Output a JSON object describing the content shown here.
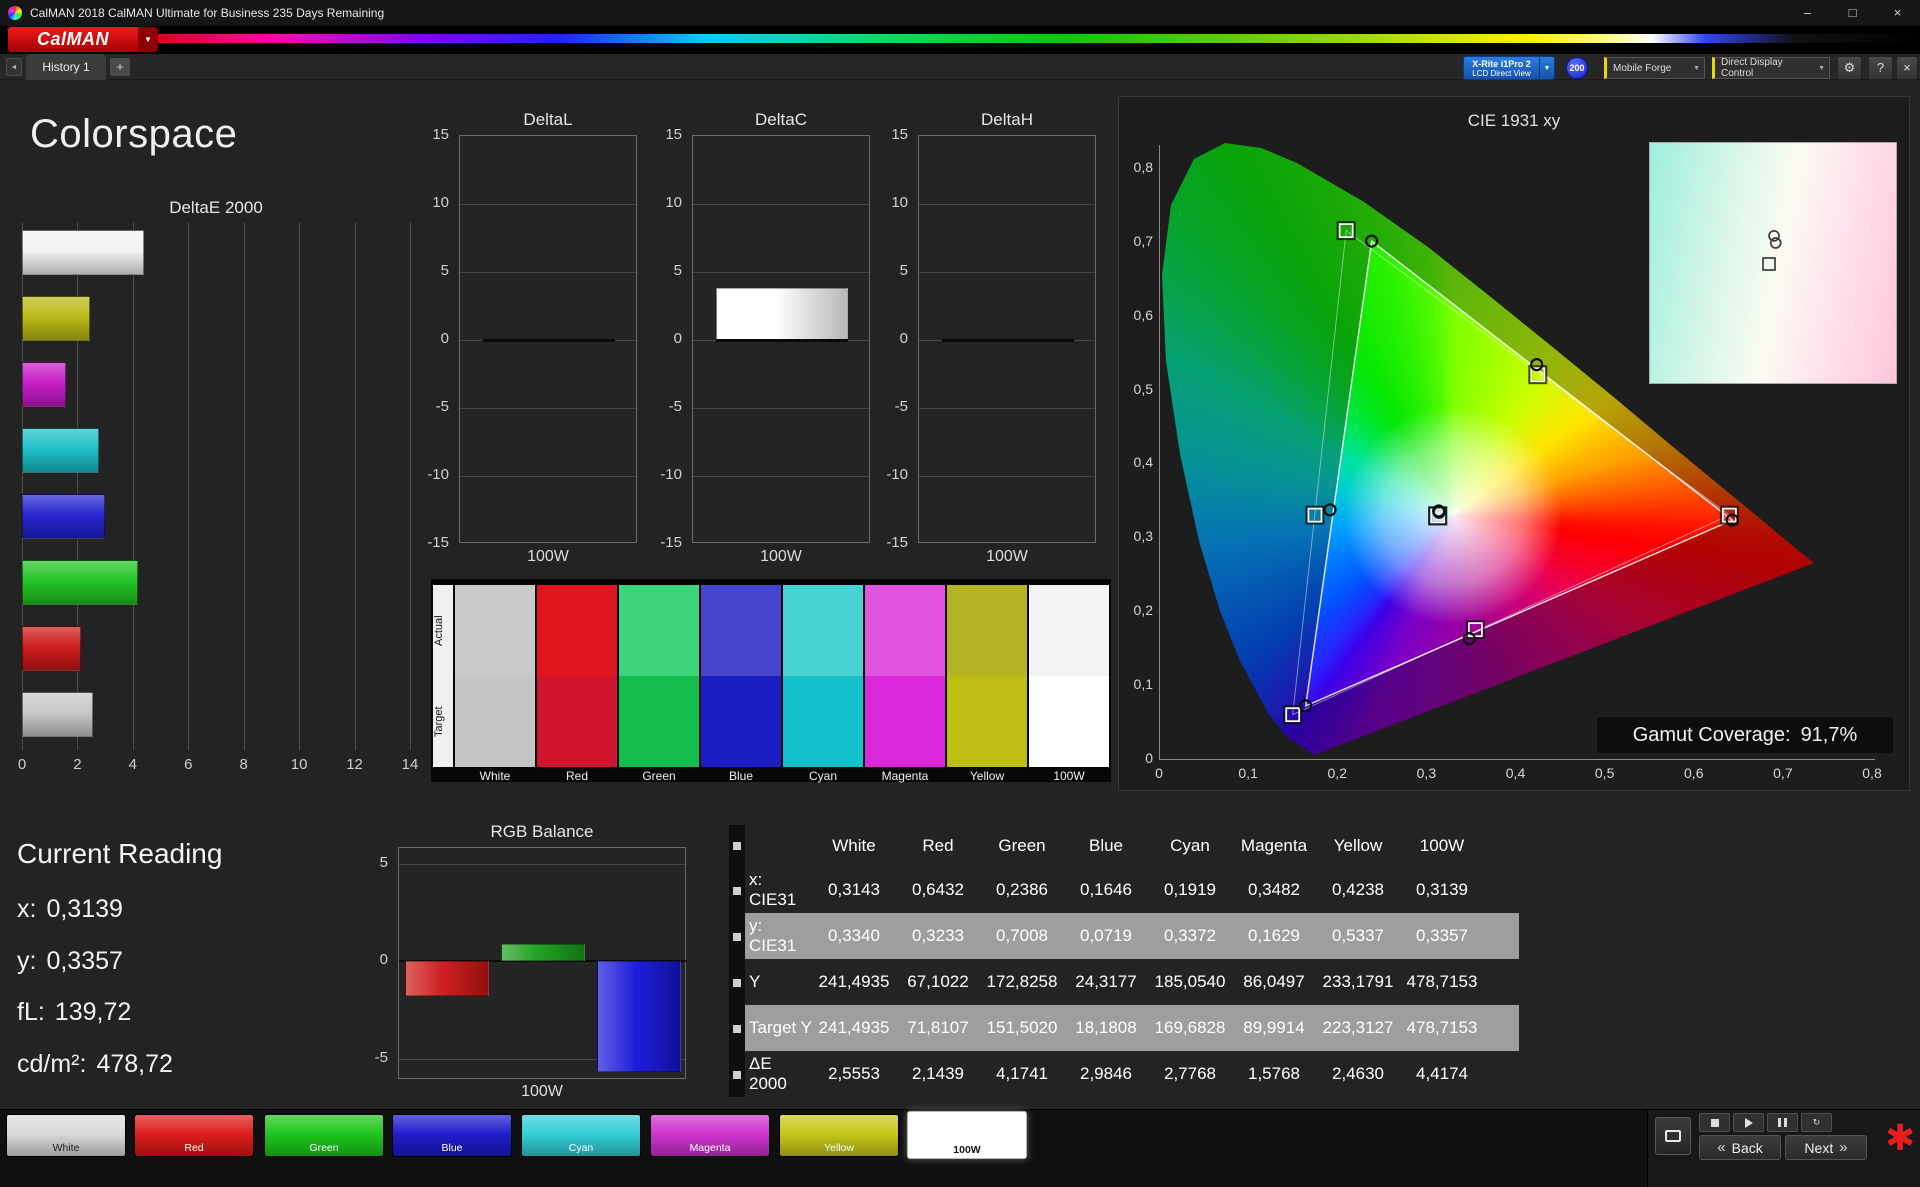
{
  "window": {
    "title": "CalMAN 2018 CalMAN Ultimate for Business 235 Days Remaining",
    "controls": [
      "minimize",
      "maximize",
      "close"
    ]
  },
  "branding": {
    "logo_text": "CalMAN"
  },
  "tabs": {
    "history_label": "History 1",
    "add_label": "+"
  },
  "toolbar": {
    "meter_line1": "X-Rite i1Pro 2",
    "meter_line2": "LCD Direct View",
    "badge": "200",
    "source": "Mobile Forge",
    "display_control": "Direct Display Control"
  },
  "page": {
    "title": "Colorspace"
  },
  "current_reading": {
    "title": "Current Reading",
    "lines": [
      {
        "label": "x:",
        "value": "0,3139"
      },
      {
        "label": "y:",
        "value": "0,3357"
      },
      {
        "label": "fL:",
        "value": "139,72"
      },
      {
        "label": "cd/m²:",
        "value": "478,72"
      }
    ]
  },
  "patch_compare": {
    "row_labels": [
      "Actual",
      "Target"
    ],
    "patches": [
      {
        "name": "White",
        "actual": "#c9c9c9",
        "target": "#c4c4c4"
      },
      {
        "name": "Red",
        "actual": "#e0151e",
        "target": "#d0142d"
      },
      {
        "name": "Green",
        "actual": "#3ed47a",
        "target": "#14bd4d"
      },
      {
        "name": "Blue",
        "actual": "#4545ce",
        "target": "#1d1dc4"
      },
      {
        "name": "Cyan",
        "actual": "#49d2d2",
        "target": "#14c0ca"
      },
      {
        "name": "Magenta",
        "actual": "#e054e0",
        "target": "#da28da"
      },
      {
        "name": "Yellow",
        "actual": "#b4b424",
        "target": "#bdbd12"
      },
      {
        "name": "100W",
        "actual": "#f4f4f4",
        "target": "#ffffff"
      }
    ]
  },
  "table": {
    "columns": [
      "White",
      "Red",
      "Green",
      "Blue",
      "Cyan",
      "Magenta",
      "Yellow",
      "100W"
    ],
    "rows": [
      {
        "label": "x: CIE31",
        "shade": false,
        "values": [
          "0,3143",
          "0,6432",
          "0,2386",
          "0,1646",
          "0,1919",
          "0,3482",
          "0,4238",
          "0,3139"
        ]
      },
      {
        "label": "y: CIE31",
        "shade": true,
        "values": [
          "0,3340",
          "0,3233",
          "0,7008",
          "0,0719",
          "0,3372",
          "0,1629",
          "0,5337",
          "0,3357"
        ]
      },
      {
        "label": "Y",
        "shade": false,
        "values": [
          "241,4935",
          "67,1022",
          "172,8258",
          "24,3177",
          "185,0540",
          "86,0497",
          "233,1791",
          "478,7153"
        ]
      },
      {
        "label": "Target Y",
        "shade": true,
        "values": [
          "241,4935",
          "71,8107",
          "151,5020",
          "18,1808",
          "169,6828",
          "89,9914",
          "223,3127",
          "478,7153"
        ]
      },
      {
        "label": "ΔE 2000",
        "shade": false,
        "values": [
          "2,5553",
          "2,1439",
          "4,1741",
          "2,9846",
          "2,7768",
          "1,5768",
          "2,4630",
          "4,4174"
        ]
      }
    ]
  },
  "bottom_bar": {
    "back_label": "Back",
    "next_label": "Next",
    "patches": [
      {
        "label": "White",
        "color": "#d9d9d9",
        "text_color": "#222222",
        "selected": false
      },
      {
        "label": "Red",
        "color": "#dd1515",
        "text_color": "#ffffff",
        "selected": false
      },
      {
        "label": "Green",
        "color": "#17c517",
        "text_color": "#ffffff",
        "selected": false
      },
      {
        "label": "Blue",
        "color": "#1717cc",
        "text_color": "#ffffff",
        "selected": false
      },
      {
        "label": "Cyan",
        "color": "#2eccd6",
        "text_color": "#ffffff",
        "selected": false
      },
      {
        "label": "Magenta",
        "color": "#cc2ecc",
        "text_color": "#ffffff",
        "selected": false
      },
      {
        "label": "Yellow",
        "color": "#c5c514",
        "text_color": "#ffffff",
        "selected": false
      },
      {
        "label": "100W",
        "color": "#ffffff",
        "text_color": "#111111",
        "selected": true
      }
    ],
    "transport_icons": [
      "screen-layout",
      "stop",
      "play",
      "pause",
      "refresh"
    ],
    "alert_icon": "asterisk"
  },
  "chart_data": [
    {
      "id": "deltae2000",
      "type": "bar",
      "orientation": "horizontal",
      "title": "DeltaE 2000",
      "categories": [
        "100W",
        "Yellow",
        "Magenta",
        "Cyan",
        "Blue",
        "Green",
        "Red",
        "White"
      ],
      "values": [
        4.4174,
        2.463,
        1.5768,
        2.7768,
        2.9846,
        4.1741,
        2.1439,
        2.5553
      ],
      "colors": [
        "#f2f2f2",
        "#b8b811",
        "#c617c6",
        "#17bfc6",
        "#2020d0",
        "#1ec41e",
        "#cc1515",
        "#c6c6c6"
      ],
      "xlim": [
        0,
        14
      ],
      "xticks": [
        0,
        2,
        4,
        6,
        8,
        10,
        12,
        14
      ],
      "grid": true
    },
    {
      "id": "deltaL",
      "type": "bar",
      "title": "DeltaL",
      "categories": [
        "100W"
      ],
      "values": [
        0
      ],
      "colors": [
        "#ffffff"
      ],
      "ylim": [
        -15,
        15
      ],
      "yticks": [
        15,
        10,
        5,
        0,
        -5,
        -10,
        -15
      ]
    },
    {
      "id": "deltaC",
      "type": "bar",
      "title": "DeltaC",
      "categories": [
        "100W"
      ],
      "values": [
        3.85
      ],
      "colors": [
        "#ffffff"
      ],
      "ylim": [
        -15,
        15
      ],
      "yticks": [
        15,
        10,
        5,
        0,
        -5,
        -10,
        -15
      ]
    },
    {
      "id": "deltaH",
      "type": "bar",
      "title": "DeltaH",
      "categories": [
        "100W"
      ],
      "values": [
        0
      ],
      "colors": [
        "#ffffff"
      ],
      "ylim": [
        -15,
        15
      ],
      "yticks": [
        15,
        10,
        5,
        0,
        -5,
        -10,
        -15
      ]
    },
    {
      "id": "rgb_balance",
      "type": "bar",
      "title": "RGB Balance",
      "xlabel": "100W",
      "categories": [
        "Red",
        "Green",
        "Blue"
      ],
      "values": [
        -1.8,
        0.9,
        -5.7
      ],
      "colors": [
        "#cc1616",
        "#1a9e1a",
        "#1616d9"
      ],
      "ylim": [
        -6.1,
        5.8
      ],
      "yticks": [
        5,
        0,
        -5
      ]
    },
    {
      "id": "cie1931",
      "type": "scatter",
      "title": "CIE 1931 xy",
      "xlim": [
        0,
        0.8
      ],
      "ylim": [
        0,
        0.8
      ],
      "xtick_labels": [
        "0",
        "0,1",
        "0,2",
        "0,3",
        "0,4",
        "0,5",
        "0,6",
        "0,7",
        "0,8"
      ],
      "ytick_labels": [
        "0",
        "0,1",
        "0,2",
        "0,3",
        "0,4",
        "0,5",
        "0,6",
        "0,7",
        "0,8"
      ],
      "gamut_label": "Gamut Coverage:",
      "gamut_value": "91,7%",
      "measured_points": [
        {
          "name": "White",
          "x": 0.3143,
          "y": 0.334
        },
        {
          "name": "Red",
          "x": 0.6432,
          "y": 0.3233
        },
        {
          "name": "Green",
          "x": 0.2386,
          "y": 0.7008
        },
        {
          "name": "Blue",
          "x": 0.1646,
          "y": 0.0719
        },
        {
          "name": "Cyan",
          "x": 0.1919,
          "y": 0.3372
        },
        {
          "name": "Magenta",
          "x": 0.3482,
          "y": 0.1629
        },
        {
          "name": "Yellow",
          "x": 0.4238,
          "y": 0.5337
        },
        {
          "name": "100W",
          "x": 0.3139,
          "y": 0.3357
        }
      ],
      "target_points": [
        {
          "name": "White",
          "x": 0.3127,
          "y": 0.329
        },
        {
          "name": "Red",
          "x": 0.64,
          "y": 0.33
        },
        {
          "name": "Green",
          "x": 0.21,
          "y": 0.715
        },
        {
          "name": "Blue",
          "x": 0.15,
          "y": 0.06
        },
        {
          "name": "Cyan",
          "x": 0.175,
          "y": 0.33
        },
        {
          "name": "Magenta",
          "x": 0.355,
          "y": 0.175
        },
        {
          "name": "Yellow",
          "x": 0.425,
          "y": 0.52
        },
        {
          "name": "100W",
          "x": 0.3127,
          "y": 0.329
        }
      ],
      "measured_triangle": [
        [
          0.6432,
          0.3233
        ],
        [
          0.2386,
          0.7008
        ],
        [
          0.1646,
          0.0719
        ]
      ],
      "target_triangle": [
        [
          0.64,
          0.33
        ],
        [
          0.21,
          0.715
        ],
        [
          0.15,
          0.06
        ]
      ]
    }
  ]
}
